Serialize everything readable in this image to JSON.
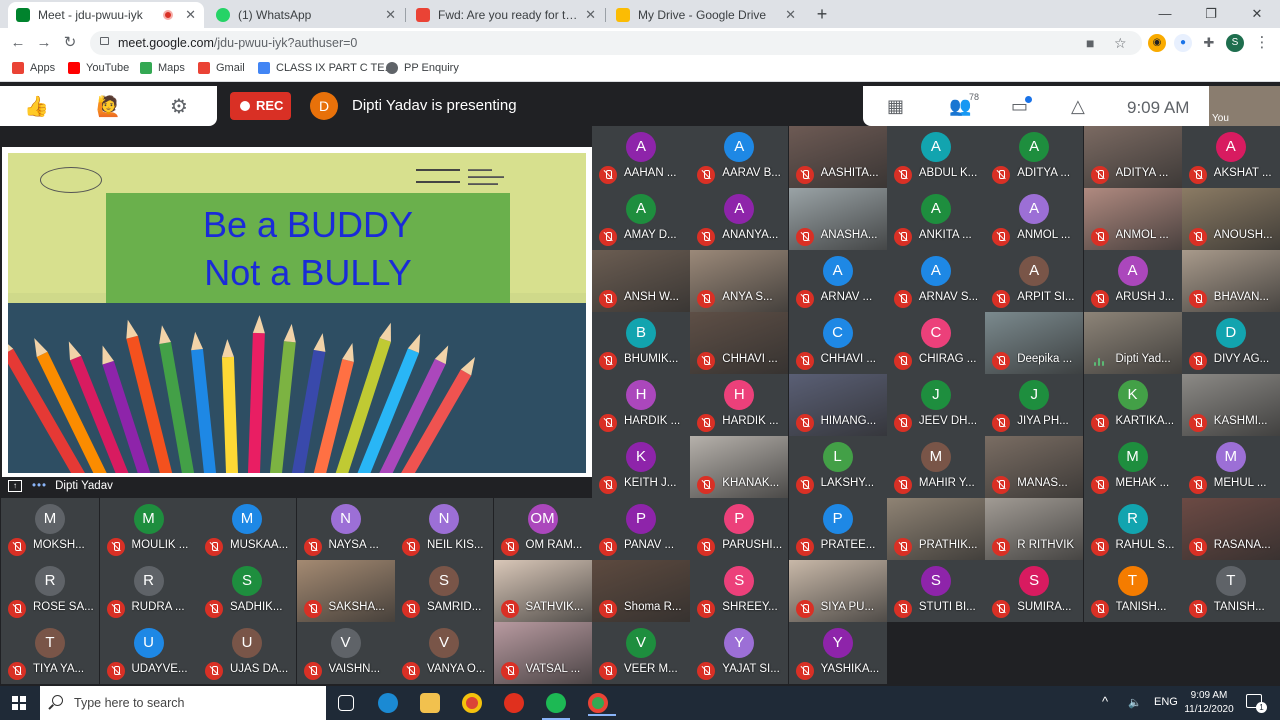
{
  "browser": {
    "tabs": [
      {
        "title": "Meet - jdu-pwuu-iyk",
        "favicon_color": "#00832d",
        "recording": true,
        "active": true
      },
      {
        "title": "(1) WhatsApp",
        "favicon_color": "#25d366",
        "recording": false,
        "active": false
      },
      {
        "title": "Fwd: Are you ready for the BIGGE",
        "favicon_color": "#ea4335",
        "recording": false,
        "active": false
      },
      {
        "title": "My Drive - Google Drive",
        "favicon_color": "#fbbc04",
        "recording": false,
        "active": false
      }
    ],
    "new_tab": "+",
    "url_host": "meet.google.com",
    "url_path": "/jdu-pwuu-iyk?authuser=0",
    "profile_initial": "S",
    "bookmarks": [
      {
        "label": "Apps",
        "icon_color": "#ea4335"
      },
      {
        "label": "YouTube",
        "icon_color": "#ff0000"
      },
      {
        "label": "Maps",
        "icon_color": "#34a853"
      },
      {
        "label": "Gmail",
        "icon_color": "#ea4335"
      },
      {
        "label": "CLASS IX PART C TE...",
        "icon_color": "#4285f4"
      },
      {
        "label": "PP Enquiry",
        "icon_color": "#5f6368"
      }
    ]
  },
  "meet": {
    "rec_label": "REC",
    "presenter_initial": "D",
    "presenting_text": "Dipti Yadav is presenting",
    "participant_count": "78",
    "time": "9:09 AM",
    "self_label": "You",
    "presentation_label": "Dipti Yadav",
    "slide": {
      "line1": "Be a BUDDY",
      "line2": "Not a BULLY"
    }
  },
  "tiles": [
    {
      "initial": "A",
      "name": "AAHAN ...",
      "color": "#8e24aa",
      "video": false
    },
    {
      "initial": "A",
      "name": "AARAV B...",
      "color": "#1e88e5",
      "video": false
    },
    {
      "initial": "",
      "name": "AASHITA...",
      "color": "#6d5a54",
      "video": true
    },
    {
      "initial": "A",
      "name": "ABDUL K...",
      "color": "#12a4af",
      "video": false
    },
    {
      "initial": "A",
      "name": "ADITYA ...",
      "color": "#1e8e3e",
      "video": false
    },
    {
      "initial": "",
      "name": "ADITYA ...",
      "color": "#7b6a62",
      "video": true
    },
    {
      "initial": "A",
      "name": "AKSHAT ...",
      "color": "#d81b60",
      "video": false
    },
    {
      "initial": "A",
      "name": "AMAY D...",
      "color": "#1e8e3e",
      "video": false
    },
    {
      "initial": "A",
      "name": "ANANYA...",
      "color": "#8e24aa",
      "video": false
    },
    {
      "initial": "",
      "name": "ANASHA...",
      "color": "#9aa3a6",
      "video": true
    },
    {
      "initial": "A",
      "name": "ANKITA ...",
      "color": "#1e8e3e",
      "video": false
    },
    {
      "initial": "A",
      "name": "ANMOL ...",
      "color": "#9c6fd6",
      "video": false
    },
    {
      "initial": "",
      "name": "ANMOL ...",
      "color": "#b08a80",
      "video": true
    },
    {
      "initial": "",
      "name": "ANOUSH...",
      "color": "#8b7b64",
      "video": true
    },
    {
      "initial": "",
      "name": "ANSH W...",
      "color": "#6b5d52",
      "video": true
    },
    {
      "initial": "",
      "name": "ANYA S...",
      "color": "#9b8979",
      "video": true
    },
    {
      "initial": "A",
      "name": "ARNAV ...",
      "color": "#1e88e5",
      "video": false
    },
    {
      "initial": "A",
      "name": "ARNAV S...",
      "color": "#1e88e5",
      "video": false
    },
    {
      "initial": "A",
      "name": "ARPIT SI...",
      "color": "#795548",
      "video": false
    },
    {
      "initial": "A",
      "name": "ARUSH J...",
      "color": "#ab47bc",
      "video": false
    },
    {
      "initial": "",
      "name": "BHAVAN...",
      "color": "#a89a8b",
      "video": true
    },
    {
      "initial": "B",
      "name": "BHUMIK...",
      "color": "#12a4af",
      "video": false
    },
    {
      "initial": "",
      "name": "CHHAVI ...",
      "color": "#5e4f46",
      "video": true
    },
    {
      "initial": "C",
      "name": "CHHAVI ...",
      "color": "#1e88e5",
      "video": false
    },
    {
      "initial": "C",
      "name": "CHIRAG ...",
      "color": "#ec407a",
      "video": false
    },
    {
      "initial": "",
      "name": "Deepika ...",
      "color": "#7b8a8e",
      "video": true
    },
    {
      "initial": "",
      "name": "Dipti Yad...",
      "color": "#8d8478",
      "video": true,
      "speaking": true
    },
    {
      "initial": "D",
      "name": "DIVY AG...",
      "color": "#12a4af",
      "video": false
    },
    {
      "initial": "H",
      "name": "HARDIK ...",
      "color": "#ab47bc",
      "video": false
    },
    {
      "initial": "H",
      "name": "HARDIK ...",
      "color": "#ec407a",
      "video": false
    },
    {
      "initial": "",
      "name": "HIMANG...",
      "color": "#5a5f75",
      "video": true
    },
    {
      "initial": "J",
      "name": "JEEV DH...",
      "color": "#1e8e3e",
      "video": false
    },
    {
      "initial": "J",
      "name": "JIYA PH...",
      "color": "#1e8e3e",
      "video": false
    },
    {
      "initial": "K",
      "name": "KARTIKA...",
      "color": "#43a047",
      "video": false
    },
    {
      "initial": "",
      "name": "KASHMI...",
      "color": "#8c8a86",
      "video": true
    },
    {
      "initial": "K",
      "name": "KEITH J...",
      "color": "#8e24aa",
      "video": false
    },
    {
      "initial": "",
      "name": "KHANAK...",
      "color": "#b6b1ab",
      "video": true
    },
    {
      "initial": "L",
      "name": "LAKSHY...",
      "color": "#43a047",
      "video": false
    },
    {
      "initial": "M",
      "name": "MAHIR Y...",
      "color": "#795548",
      "video": false
    },
    {
      "initial": "",
      "name": "MANAS...",
      "color": "#7a6d63",
      "video": true
    },
    {
      "initial": "M",
      "name": "MEHAK ...",
      "color": "#1e8e3e",
      "video": false
    },
    {
      "initial": "M",
      "name": "MEHUL ...",
      "color": "#9c6fd6",
      "video": false
    },
    {
      "initial": "P",
      "name": "PANAV ...",
      "color": "#8e24aa",
      "video": false
    },
    {
      "initial": "P",
      "name": "PARUSHI...",
      "color": "#ec407a",
      "video": false
    },
    {
      "initial": "P",
      "name": "PRATEE...",
      "color": "#1e88e5",
      "video": false
    },
    {
      "initial": "",
      "name": "PRATHIK...",
      "color": "#8f8374",
      "video": true
    },
    {
      "initial": "",
      "name": "R RITHVIK",
      "color": "#a19b94",
      "video": true
    },
    {
      "initial": "R",
      "name": "RAHUL S...",
      "color": "#12a4af",
      "video": false
    },
    {
      "initial": "",
      "name": "RASANA...",
      "color": "#6c4a44",
      "video": true
    },
    {
      "initial": "",
      "name": "Shoma R...",
      "color": "#5d4a3f",
      "video": true
    },
    {
      "initial": "S",
      "name": "SHREEY...",
      "color": "#ec407a",
      "video": false
    },
    {
      "initial": "",
      "name": "SIYA PU...",
      "color": "#c8b8a8",
      "video": true
    },
    {
      "initial": "S",
      "name": "STUTI BI...",
      "color": "#8e24aa",
      "video": false
    },
    {
      "initial": "S",
      "name": "SUMIRA...",
      "color": "#d81b60",
      "video": false
    },
    {
      "initial": "T",
      "name": "TANISH...",
      "color": "#f57c00",
      "video": false
    },
    {
      "initial": "T",
      "name": "TANISH...",
      "color": "#5f6368",
      "video": false
    },
    {
      "initial": "V",
      "name": "VEER M...",
      "color": "#1e8e3e",
      "video": false
    },
    {
      "initial": "Y",
      "name": "YAJAT SI...",
      "color": "#9c6fd6",
      "video": false
    },
    {
      "initial": "Y",
      "name": "YASHIKA...",
      "color": "#8e24aa",
      "video": false
    },
    {
      "initial": "M",
      "name": "MOKSH...",
      "color": "#5f6368",
      "video": false
    },
    {
      "initial": "M",
      "name": "MOULIK ...",
      "color": "#1e8e3e",
      "video": false
    },
    {
      "initial": "M",
      "name": "MUSKAA...",
      "color": "#1e88e5",
      "video": false
    },
    {
      "initial": "N",
      "name": "NAYSA ...",
      "color": "#9c6fd6",
      "video": false
    },
    {
      "initial": "N",
      "name": "NEIL KIS...",
      "color": "#9c6fd6",
      "video": false
    },
    {
      "initial": "OM",
      "name": "OM RAM...",
      "color": "#ab47bc",
      "video": false
    },
    {
      "initial": "R",
      "name": "ROSE SA...",
      "color": "#5f6368",
      "video": false
    },
    {
      "initial": "R",
      "name": "RUDRA ...",
      "color": "#5f6368",
      "video": false
    },
    {
      "initial": "S",
      "name": "SADHIK...",
      "color": "#1e8e3e",
      "video": false
    },
    {
      "initial": "",
      "name": "SAKSHA...",
      "color": "#a48a72",
      "video": true
    },
    {
      "initial": "S",
      "name": "SAMRID...",
      "color": "#795548",
      "video": false
    },
    {
      "initial": "",
      "name": "SATHVIK...",
      "color": "#d9c7b8",
      "video": true
    },
    {
      "initial": "T",
      "name": "TIYA YA...",
      "color": "#795548",
      "video": false
    },
    {
      "initial": "U",
      "name": "UDAYVE...",
      "color": "#1e88e5",
      "video": false
    },
    {
      "initial": "U",
      "name": "UJAS DA...",
      "color": "#795548",
      "video": false
    },
    {
      "initial": "V",
      "name": "VAISHN...",
      "color": "#5f6368",
      "video": false
    },
    {
      "initial": "V",
      "name": "VANYA O...",
      "color": "#795548",
      "video": false
    },
    {
      "initial": "",
      "name": "VATSAL ...",
      "color": "#b89aa0",
      "video": true
    }
  ],
  "taskbar": {
    "search_placeholder": "Type here to search",
    "lang": "ENG",
    "time": "9:09 AM",
    "date": "11/12/2020",
    "notification_count": "1"
  }
}
